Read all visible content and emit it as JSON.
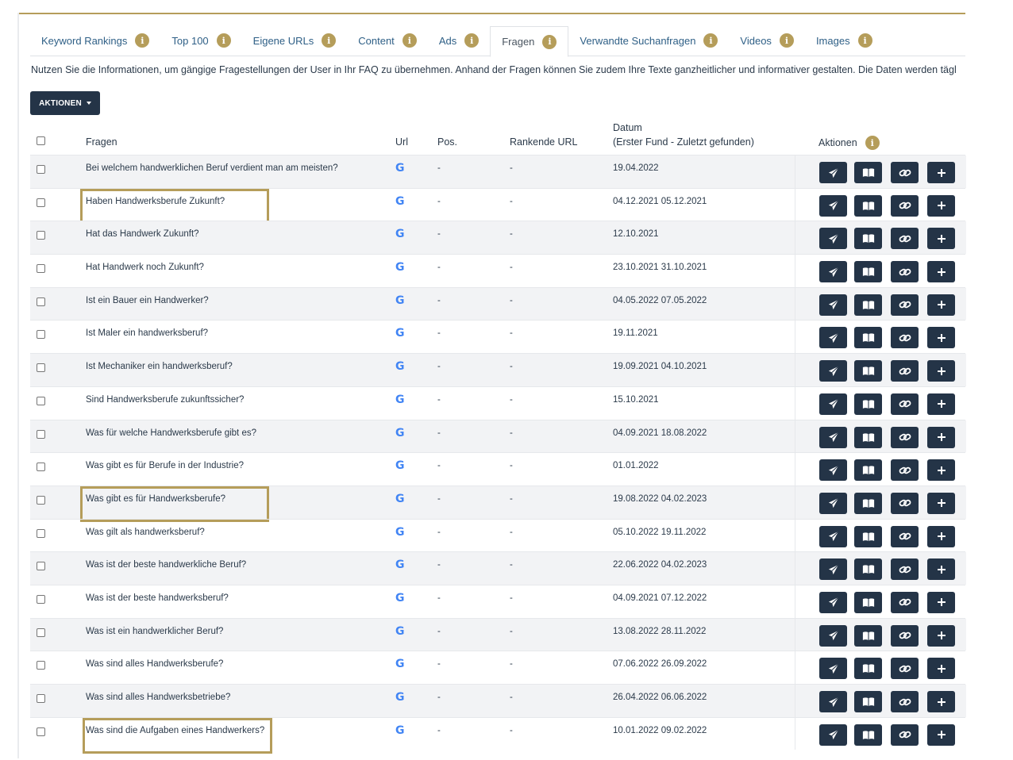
{
  "tabs": [
    {
      "label": "Keyword Rankings",
      "active": false
    },
    {
      "label": "Top 100",
      "active": false
    },
    {
      "label": "Eigene URLs",
      "active": false
    },
    {
      "label": "Content",
      "active": false
    },
    {
      "label": "Ads",
      "active": false
    },
    {
      "label": "Fragen",
      "active": true
    },
    {
      "label": "Verwandte Suchanfragen",
      "active": false
    },
    {
      "label": "Videos",
      "active": false
    },
    {
      "label": "Images",
      "active": false
    }
  ],
  "info_glyph": "i",
  "description": "Nutzen Sie die Informationen, um gängige Fragestellungen der User in Ihr FAQ zu übernehmen. Anhand der Fragen können Sie zudem Ihre Texte ganzheitlicher und informativer gestalten. Die Daten werden tägl",
  "actions_button": "AKTIONEN",
  "table": {
    "headers": {
      "question": "Fragen",
      "url": "Url",
      "pos": "Pos.",
      "ranking_url": "Rankende URL",
      "date_line1": "Datum",
      "date_line2": "(Erster Fund - Zuletzt gefunden)",
      "actions": "Aktionen"
    },
    "google_glyph": "G",
    "rows": [
      {
        "question": "Bei welchem handwerklichen Beruf verdient man am meisten?",
        "pos": "-",
        "ranking_url": "-",
        "date": "19.04.2022",
        "highlighted": false
      },
      {
        "question": "Haben Handwerksberufe Zukunft?",
        "pos": "-",
        "ranking_url": "-",
        "date": "04.12.2021 05.12.2021",
        "highlighted": true
      },
      {
        "question": "Hat das Handwerk Zukunft?",
        "pos": "-",
        "ranking_url": "-",
        "date": "12.10.2021",
        "highlighted": false
      },
      {
        "question": "Hat Handwerk noch Zukunft?",
        "pos": "-",
        "ranking_url": "-",
        "date": "23.10.2021 31.10.2021",
        "highlighted": false
      },
      {
        "question": "Ist ein Bauer ein Handwerker?",
        "pos": "-",
        "ranking_url": "-",
        "date": "04.05.2022 07.05.2022",
        "highlighted": false
      },
      {
        "question": "Ist Maler ein handwerksberuf?",
        "pos": "-",
        "ranking_url": "-",
        "date": "19.11.2021",
        "highlighted": false
      },
      {
        "question": "Ist Mechaniker ein handwerksberuf?",
        "pos": "-",
        "ranking_url": "-",
        "date": "19.09.2021 04.10.2021",
        "highlighted": false
      },
      {
        "question": "Sind Handwerksberufe zukunftssicher?",
        "pos": "-",
        "ranking_url": "-",
        "date": "15.10.2021",
        "highlighted": false
      },
      {
        "question": "Was für welche Handwerksberufe gibt es?",
        "pos": "-",
        "ranking_url": "-",
        "date": "04.09.2021 18.08.2022",
        "highlighted": false
      },
      {
        "question": "Was gibt es für Berufe in der Industrie?",
        "pos": "-",
        "ranking_url": "-",
        "date": "01.01.2022",
        "highlighted": false
      },
      {
        "question": "Was gibt es für Handwerksberufe?",
        "pos": "-",
        "ranking_url": "-",
        "date": "19.08.2022 04.02.2023",
        "highlighted": true
      },
      {
        "question": "Was gilt als handwerksberuf?",
        "pos": "-",
        "ranking_url": "-",
        "date": "05.10.2022 19.11.2022",
        "highlighted": false
      },
      {
        "question": "Was ist der beste handwerkliche Beruf?",
        "pos": "-",
        "ranking_url": "-",
        "date": "22.06.2022 04.02.2023",
        "highlighted": false
      },
      {
        "question": "Was ist der beste handwerksberuf?",
        "pos": "-",
        "ranking_url": "-",
        "date": "04.09.2021 07.12.2022",
        "highlighted": false
      },
      {
        "question": "Was ist ein handwerklicher Beruf?",
        "pos": "-",
        "ranking_url": "-",
        "date": "13.08.2022 28.11.2022",
        "highlighted": false
      },
      {
        "question": "Was sind alles Handwerksberufe?",
        "pos": "-",
        "ranking_url": "-",
        "date": "07.06.2022 26.09.2022",
        "highlighted": false
      },
      {
        "question": "Was sind alles Handwerksbetriebe?",
        "pos": "-",
        "ranking_url": "-",
        "date": "26.04.2022 06.06.2022",
        "highlighted": false
      },
      {
        "question": "Was sind die Aufgaben eines Handwerkers?",
        "pos": "-",
        "ranking_url": "-",
        "date": "10.01.2022 09.02.2022",
        "highlighted": true
      }
    ],
    "row_actions": [
      "send-icon",
      "book-icon",
      "link-icon",
      "plus-icon"
    ]
  },
  "colors": {
    "accent_gold": "#b59d5a",
    "button_dark": "#243447",
    "tab_link": "#2e5f86",
    "google_blue": "#4285f4"
  }
}
